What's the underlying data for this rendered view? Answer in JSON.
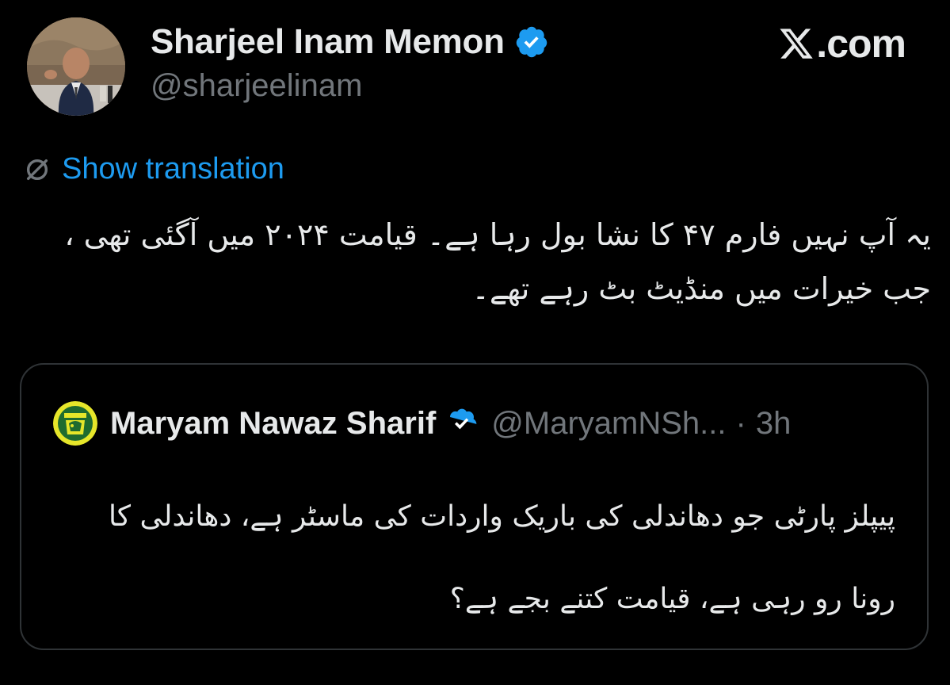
{
  "colors": {
    "background": "#000000",
    "text_primary": "#e7e9ea",
    "text_secondary": "#71767b",
    "link": "#1d9bf0",
    "verified_badge": "#1d9bf0",
    "card_border": "#2f3336"
  },
  "post": {
    "author": {
      "name": "Sharjeel Inam Memon",
      "handle": "@sharjeelinam",
      "avatar_icon": "avatar-photo",
      "verified_icon": "verified-badge-icon"
    },
    "brand": {
      "icon": "x-logo-icon",
      "text": ".com"
    },
    "translation": {
      "icon": "globe-icon",
      "label": "Show translation"
    },
    "text": "یہ آپ نہیں فارم ۴۷ کا نشا بول رہا ہے۔ قیامت ۲۰۲۴ میں آگئی تھی ، جب خیرات میں منڈیٹ بٹ رہے تھے۔"
  },
  "quote": {
    "author": {
      "name": "Maryam Nawaz Sharif",
      "handle": "@MaryamNSh...",
      "separator": "·",
      "time": "3h",
      "avatar_icon": "party-logo-avatar",
      "verified_icon": "verified-badge-icon"
    },
    "text": "پیپلز پارٹی جو دھاندلی کی باریک واردات کی ماسٹر ہے، دھاندلی کا رونا رو رہی ہے، قیامت کتنے بجے ہے؟"
  }
}
